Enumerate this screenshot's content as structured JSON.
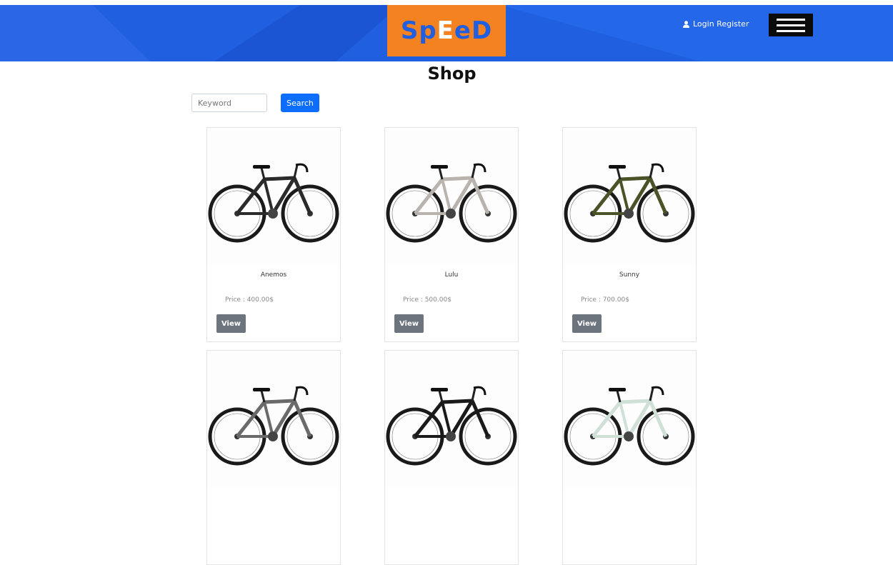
{
  "header": {
    "logo_letters": [
      {
        "char": "S",
        "color": "#1f5fe0"
      },
      {
        "char": "p",
        "color": "#1f5fe0"
      },
      {
        "char": "E",
        "color": "#ffffff"
      },
      {
        "char": "e",
        "color": "#1f5fe0"
      },
      {
        "char": "D",
        "color": "#1f5fe0"
      }
    ],
    "login_register": "Login Register",
    "user_icon": "user-icon",
    "menu_icon": "hamburger-menu-icon",
    "bg_color": "#1f5fe0",
    "logo_bg": "#f58220"
  },
  "page": {
    "title": "Shop"
  },
  "search": {
    "placeholder": "Keyword",
    "button": "Search"
  },
  "products": [
    {
      "name": "Anemos",
      "price": "Price : 400.00$",
      "view": "View",
      "frame_color": "#2b2b2b"
    },
    {
      "name": "Lulu",
      "price": "Price : 500.00$",
      "view": "View",
      "frame_color": "#b9b3ad"
    },
    {
      "name": "Sunny",
      "price": "Price : 700.00$",
      "view": "View",
      "frame_color": "#4a5228"
    },
    {
      "name": "",
      "price": "",
      "view": "",
      "frame_color": "#6a6a6a"
    },
    {
      "name": "",
      "price": "",
      "view": "",
      "frame_color": "#1a1a1a"
    },
    {
      "name": "",
      "price": "",
      "view": "",
      "frame_color": "#cfe0d6"
    }
  ]
}
